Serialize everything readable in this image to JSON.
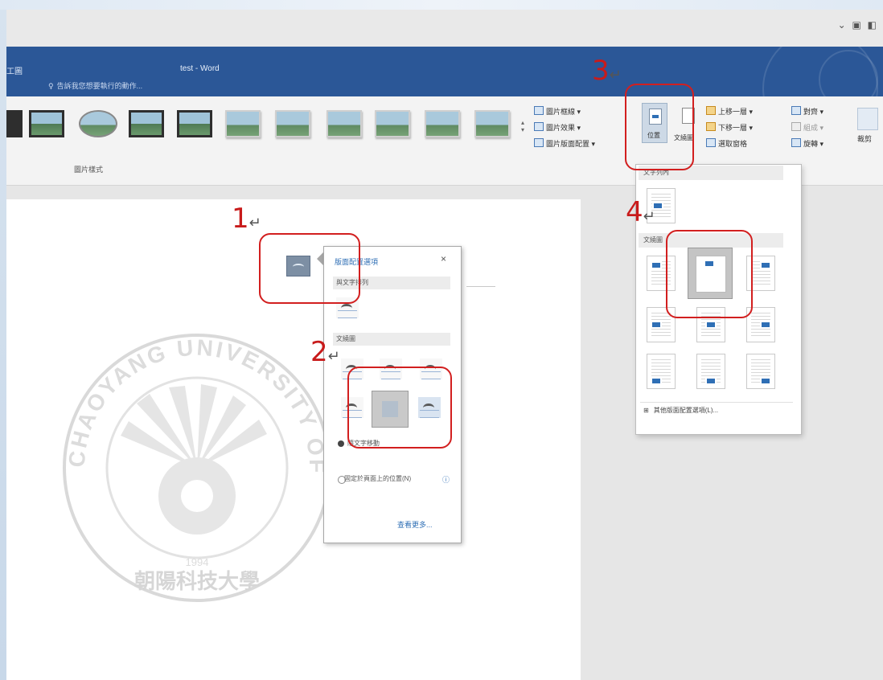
{
  "window": {
    "tab_name": "工圖",
    "title": "test - Word",
    "tell_me": "告訴我您想要執行的動作..."
  },
  "ribbon": {
    "picture_styles_group": "圖片樣式",
    "commands": {
      "border": "圖片框線",
      "effects": "圖片效果",
      "layout": "圖片版面配置",
      "position": "位置",
      "wrap_text": "文繞圖",
      "bring_forward": "上移一層",
      "send_backward": "下移一層",
      "selection_pane": "選取窗格",
      "align": "對齊",
      "group": "組成",
      "rotate": "旋轉",
      "crop": "裁剪"
    }
  },
  "annotations": {
    "one": "1",
    "two": "2",
    "three": "3",
    "four": "4",
    "return_mark": "↵"
  },
  "layout_popup": {
    "title": "版面配置選項",
    "close": "×",
    "section_inline": "與文字排列",
    "section_wrap": "文繞圖",
    "option_move": "隨文字移動",
    "option_fix": "固定於頁面上的位置(N)",
    "info": "ⓘ",
    "see_more": "查看更多..."
  },
  "position_dropdown": {
    "section_inline": "文字列內",
    "section_wrap": "文繞圖",
    "more": "其他版面配置選項(L)..."
  },
  "watermark": {
    "top_arc": "CHAOYANG UNIVERSITY OF TECHNOLOGY",
    "bottom": "朝陽科技大學",
    "year": "1994"
  },
  "colors": {
    "title_bar": "#2b5797",
    "annotation_red": "#d21f1f",
    "link_blue": "#2f6fb5"
  }
}
